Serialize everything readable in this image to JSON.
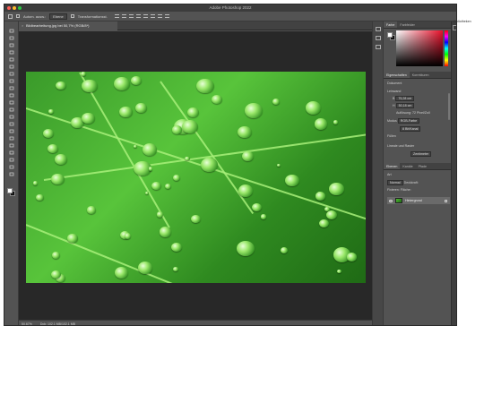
{
  "app": {
    "window_title": "Adobe Photoshop 2022",
    "traffic_colors": [
      "#ff5f57",
      "#febc2e",
      "#28c840"
    ]
  },
  "options_bar": {
    "auto_select_label": "Autom. ausw.:",
    "layer_dropdown": "Ebene",
    "transform_label": "Transformationsst."
  },
  "document_tab": {
    "title": "Bildbearbeitung.jpg bei 50,7% (RGB/8*)"
  },
  "status_bar": {
    "zoom": "50,67%",
    "doc_info": "Dok: 102,1 MB/102,1 MB"
  },
  "tools": [
    "move-tool-icon",
    "artboard-tool-icon",
    "lasso-tool-icon",
    "quick-select-tool-icon",
    "crop-tool-icon",
    "frame-tool-icon",
    "eyedropper-tool-icon",
    "healing-brush-tool-icon",
    "brush-tool-icon",
    "clone-stamp-tool-icon",
    "history-brush-tool-icon",
    "eraser-tool-icon",
    "gradient-tool-icon",
    "blur-tool-icon",
    "dodge-tool-icon",
    "pen-tool-icon",
    "type-tool-icon",
    "path-select-tool-icon",
    "rectangle-tool-icon",
    "hand-tool-icon",
    "zoom-tool-icon"
  ],
  "color_panel": {
    "tabs": [
      "Farbe",
      "Farbfelder"
    ],
    "hue_color": "#e8102a"
  },
  "properties_panel": {
    "tabs": [
      "Eigenschaften",
      "Korrekturen"
    ],
    "section_document": "Dokument",
    "section_canvas": "Leinwand",
    "width_value": "75,28 cm",
    "height_value": "50,18 cm",
    "resolution_text": "Auflösung: 72 Pixel/Zoll",
    "mode_label": "Modus",
    "mode_value": "RGB-Farbe",
    "depth_value": "8 Bit/Kanal",
    "fill_label": "Füllen",
    "section_rulers": "Lineale und Raster",
    "units_value": "Zentimeter"
  },
  "layers_panel": {
    "tabs": [
      "Ebenen",
      "Kanäle",
      "Pfade"
    ],
    "filter_label": "Art",
    "blend_label": "Normal",
    "opacity_label": "Deckkraft:",
    "lock_label": "Fixieren:",
    "fill_label": "Fläche:",
    "layer_name": "Hintergrund"
  },
  "far_panel": {
    "label": "Bibliotheken"
  },
  "photo": {
    "accent": "#58c43b"
  }
}
